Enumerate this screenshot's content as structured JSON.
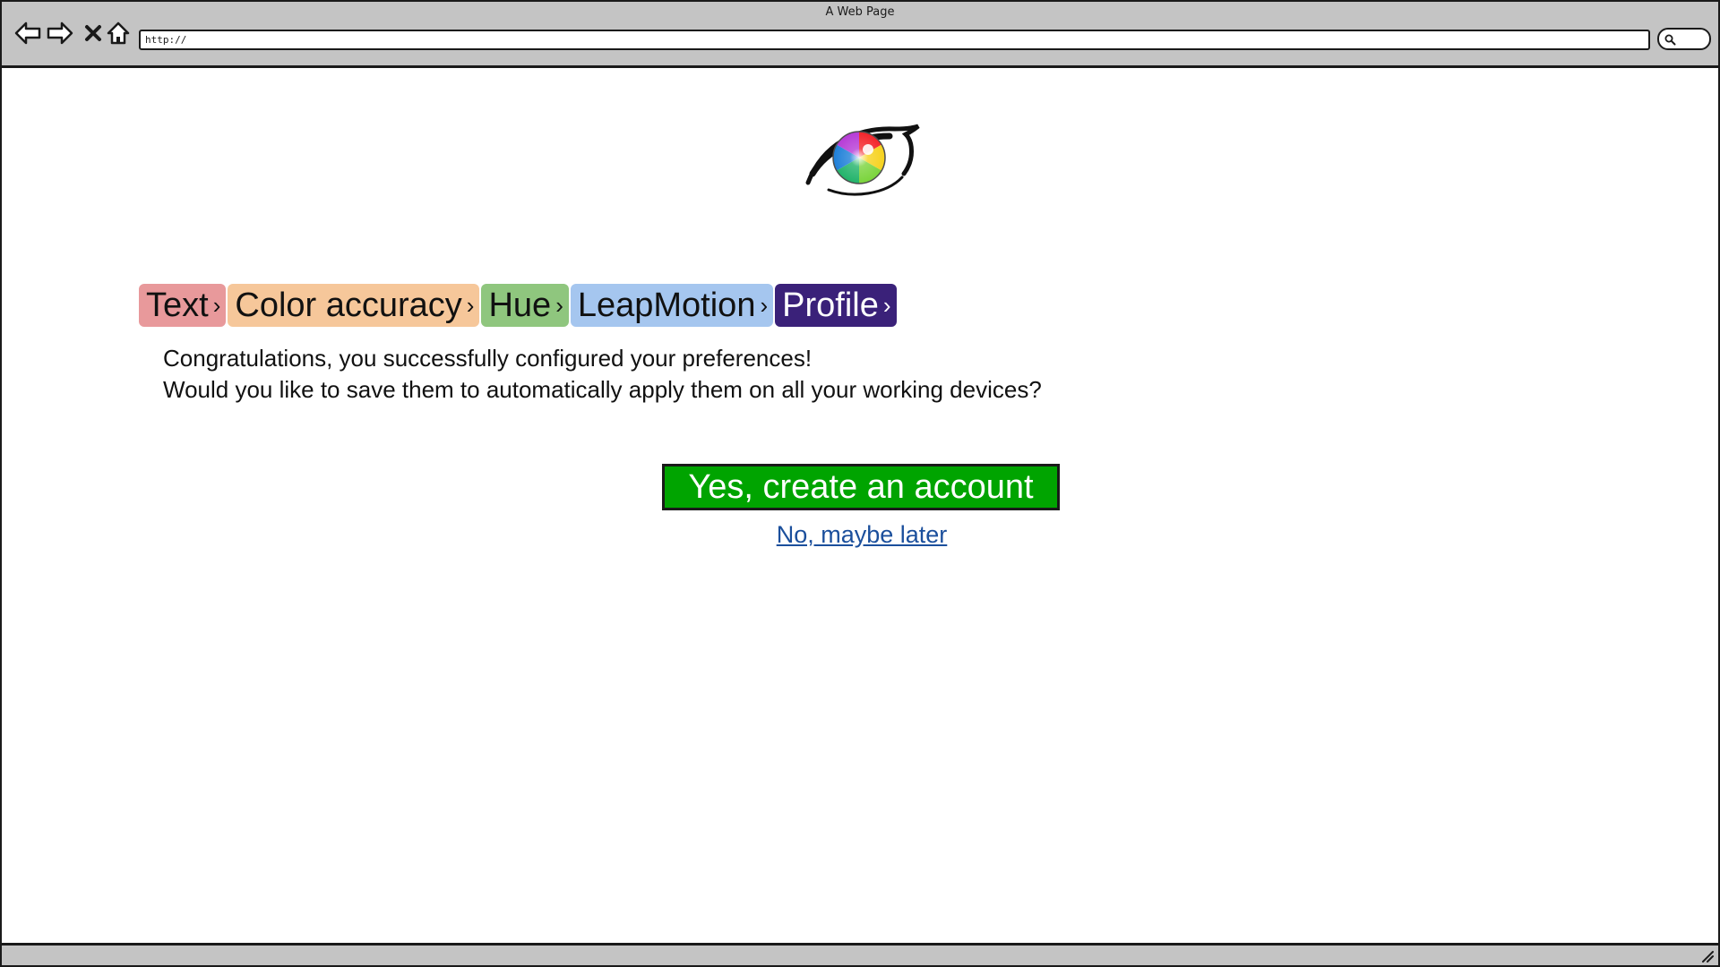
{
  "window": {
    "title": "A Web Page"
  },
  "browser": {
    "url": "http://",
    "icons": {
      "back": "arrow-left-icon",
      "forward": "arrow-right-icon",
      "stop": "close-icon",
      "home": "home-icon",
      "search": "search-icon"
    }
  },
  "breadcrumb": {
    "separator": "›",
    "items": [
      {
        "label": "Text",
        "bg": "#e8999b",
        "fg": "#111111"
      },
      {
        "label": "Color accuracy",
        "bg": "#f6c79a",
        "fg": "#111111"
      },
      {
        "label": "Hue",
        "bg": "#8fc67e",
        "fg": "#111111"
      },
      {
        "label": "LeapMotion",
        "bg": "#a5c6ef",
        "fg": "#111111"
      },
      {
        "label": "Profile",
        "bg": "#3a2179",
        "fg": "#ffffff"
      }
    ]
  },
  "message": {
    "line1": "Congratulations, you successfully configured your preferences!",
    "line2": "Would you like to save them to automatically apply them on all your working devices?"
  },
  "actions": {
    "primary_label": "Yes, create an account",
    "secondary_label": "No, maybe later"
  },
  "colors": {
    "primary_button": "#00a400",
    "link": "#1b4f9c",
    "chrome": "#c4c4c4"
  }
}
